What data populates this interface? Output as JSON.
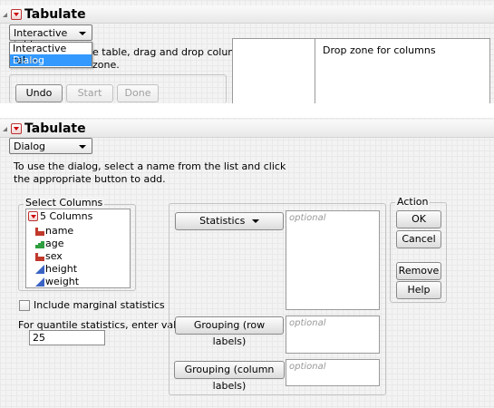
{
  "top_panel": {
    "title": "Tabulate",
    "combo_value": "Interactive table",
    "dropdown_options": [
      "Interactive table",
      "Dialog"
    ],
    "dropdown_selected": "Dialog",
    "instruction_line1": "e table, drag and drop columns or",
    "instruction_line2": "zone.",
    "buttons": {
      "undo": "Undo",
      "start_over": "Start Over",
      "done": "Done"
    },
    "drop_zone_columns": "Drop zone for columns"
  },
  "dialog_panel": {
    "title": "Tabulate",
    "combo_value": "Dialog",
    "instructions": [
      "To use the dialog, select a name from the list and click",
      "the appropriate button to add."
    ],
    "select_columns": {
      "label": "Select Columns",
      "count": "5 Columns",
      "columns": [
        {
          "name": "name",
          "type": "nominal"
        },
        {
          "name": "age",
          "type": "ordinal"
        },
        {
          "name": "sex",
          "type": "nominal"
        },
        {
          "name": "height",
          "type": "continuous"
        },
        {
          "name": "weight",
          "type": "continuous"
        }
      ]
    },
    "marginal_label": "Include marginal statistics",
    "quantile_label": "For quantile statistics, enter value (%)",
    "quantile_value": "25",
    "role_buttons": {
      "statistics": "Statistics",
      "grouping_rows": "Grouping (row labels)",
      "grouping_columns": "Grouping (column labels)"
    },
    "optional": "optional",
    "action": {
      "label": "Action",
      "ok": "OK",
      "cancel": "Cancel",
      "remove": "Remove",
      "help": "Help"
    }
  },
  "colors": {
    "nominal": "#c0392b",
    "ordinal": "#2e9e3e",
    "continuous": "#3a63c4",
    "selection": "#3399ff"
  }
}
